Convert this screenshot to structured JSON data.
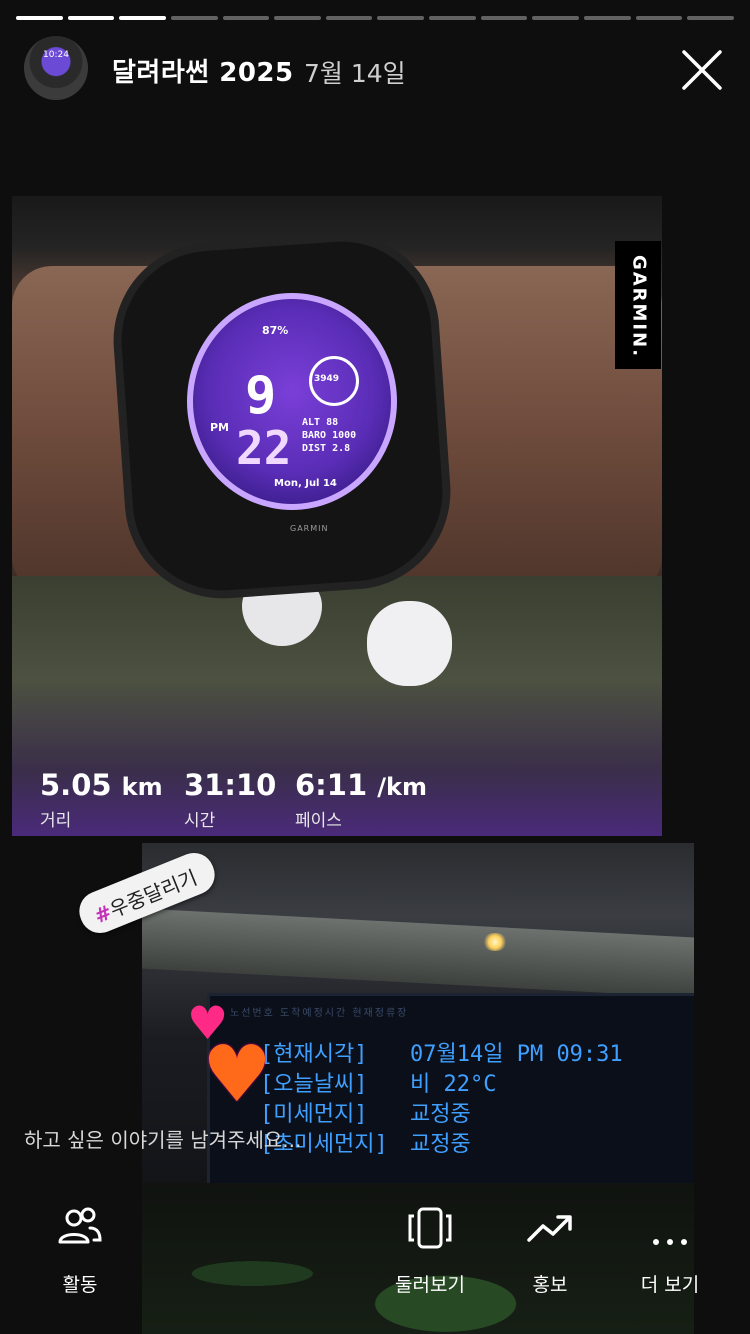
{
  "story": {
    "segments_total": 14,
    "segments_done": 3,
    "account_name": "달려라썬 2025",
    "date": "7월 14일",
    "avatar_text": "10:24"
  },
  "photo1": {
    "watch": {
      "battery": "87%",
      "hour": "9",
      "minute": "22",
      "ampm": "PM",
      "steps": "3949",
      "alt": "ALT 88",
      "baro": "BARO 1000",
      "dist": "DIST 2.8",
      "date": "Mon, Jul 14",
      "brand": "GARMIN"
    },
    "garmin_sticker": "GARMIN."
  },
  "stats": [
    {
      "value": "5.05",
      "unit": "km",
      "label": "거리"
    },
    {
      "value": "31:10",
      "unit": "",
      "label": "시간"
    },
    {
      "value": "6:11",
      "unit": "/km",
      "label": "페이스"
    }
  ],
  "photo2": {
    "board_header": "노선번호   도착예정시간   현재정류장",
    "led": [
      {
        "label": "[현재시각]",
        "value": "07월14일 PM 09:31"
      },
      {
        "label": "[오늘날씨]",
        "value": "비 22°C"
      },
      {
        "label": "[미세먼지]",
        "value": "교정중"
      },
      {
        "label": "[초미세먼지]",
        "value": "교정중"
      }
    ]
  },
  "hashtag": {
    "hash": "#",
    "text": "우중달리기"
  },
  "reply_placeholder": "하고 싶은 이야기를 남겨주세요...",
  "bottom_nav": [
    {
      "label": "활동",
      "icon": "people-icon"
    },
    {
      "label": "둘러보기",
      "icon": "carousel-icon"
    },
    {
      "label": "홍보",
      "icon": "trending-up-icon"
    },
    {
      "label": "더 보기",
      "icon": "more-icon"
    }
  ]
}
